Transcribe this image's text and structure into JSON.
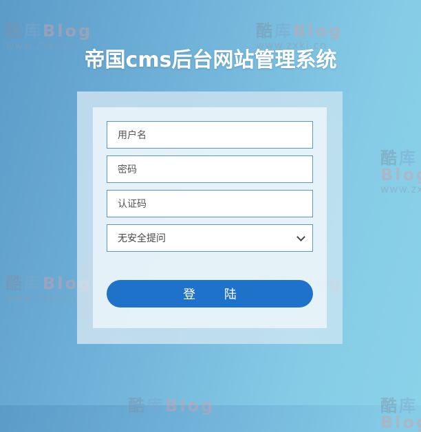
{
  "header": {
    "title": "帝国cms后台网站管理系统"
  },
  "watermark": {
    "brand_cn_1": "酷",
    "brand_cn_2": "库",
    "brand_en": "Blog",
    "url": "www.zxki.cn"
  },
  "form": {
    "username_placeholder": "用户名",
    "password_placeholder": "密码",
    "captcha_placeholder": "认证码",
    "security_question": "无安全提问",
    "login_button": "登 陆"
  }
}
